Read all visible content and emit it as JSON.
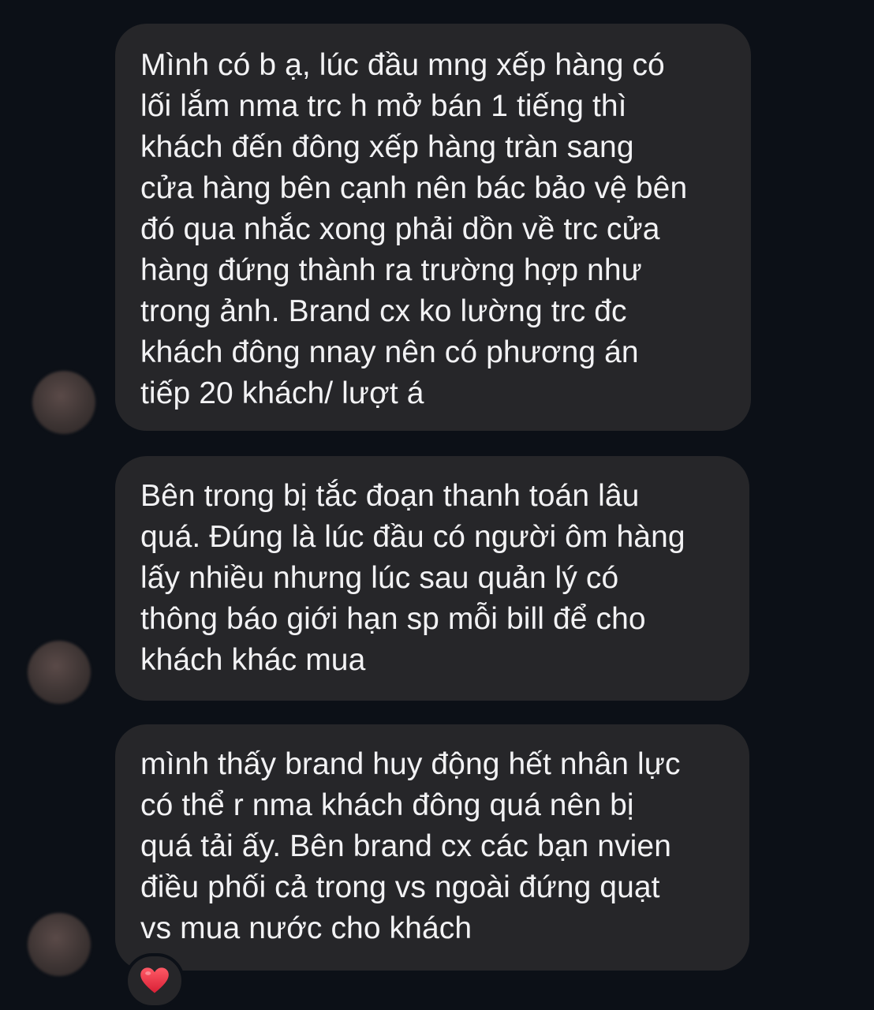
{
  "messages": [
    {
      "lines": [
        "Mình có b ạ, lúc đầu mng xếp hàng có",
        "lối lắm nma trc h mở bán 1 tiếng thì",
        "khách đến đông xếp hàng tràn sang",
        "cửa hàng bên cạnh nên bác bảo vệ bên",
        "đó qua nhắc xong phải dồn về trc cửa",
        "hàng đứng thành ra trường hợp như",
        "trong ảnh. Brand cx ko lường trc đc",
        "khách đông nnay nên có phương án",
        "tiếp 20 khách/ lượt á"
      ]
    },
    {
      "lines": [
        "Bên trong bị tắc đoạn thanh toán lâu",
        "quá. Đúng là lúc đầu có người ôm hàng",
        "lấy nhiều nhưng lúc sau quản lý có",
        "thông báo giới hạn sp mỗi bill để cho",
        "khách khác mua"
      ]
    },
    {
      "lines": [
        "mình thấy brand huy động hết nhân lực",
        "có thể r nma khách đông quá nên bị",
        "quá tải ấy. Bên brand cx các bạn nvien",
        "điều phối cả trong vs ngoài đứng quạt",
        "vs mua nước cho khách"
      ],
      "reaction": "heart-icon"
    }
  ],
  "colors": {
    "background": "#0c1017",
    "bubble": "#262629",
    "text": "#f2f2f4",
    "heart": "#e8303f"
  }
}
